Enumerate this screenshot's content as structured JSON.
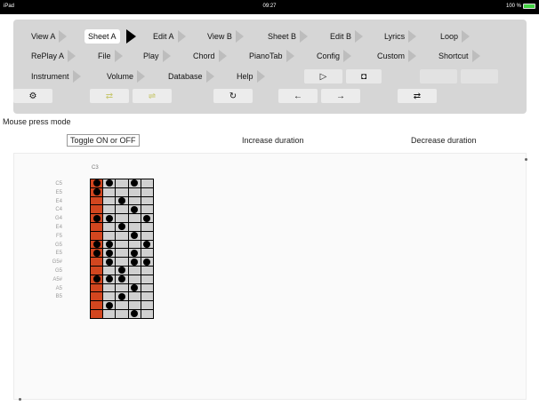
{
  "status_bar": {
    "device": "iPad",
    "time": "09:27",
    "battery": "100 %"
  },
  "menu": {
    "row1": [
      {
        "label": "View A",
        "active": false
      },
      {
        "label": "Sheet A",
        "active": true
      },
      {
        "label": "Edit A",
        "active": false
      },
      {
        "label": "View B",
        "active": false
      },
      {
        "label": "Sheet B",
        "active": false
      },
      {
        "label": "Edit B",
        "active": false
      },
      {
        "label": "Lyrics",
        "active": false
      },
      {
        "label": "Loop",
        "active": false
      }
    ],
    "row2": [
      {
        "label": "RePlay A"
      },
      {
        "label": "File"
      },
      {
        "label": "Play"
      },
      {
        "label": "Chord"
      },
      {
        "label": "PianoTab"
      },
      {
        "label": "Config"
      },
      {
        "label": "Custom"
      },
      {
        "label": "Shortcut"
      }
    ],
    "row3": [
      {
        "label": "Instrument"
      },
      {
        "label": "Volume"
      },
      {
        "label": "Database"
      },
      {
        "label": "Help"
      }
    ]
  },
  "tools": {
    "play": "▷",
    "stop": "◘",
    "settings": "⚙",
    "shuffle": "⇄",
    "swap": "⇌",
    "undo": "↻",
    "left": "←",
    "right": "→",
    "insert": "⇄"
  },
  "mode": {
    "label": "Mouse press mode",
    "options": [
      "Toggle ON or OFF",
      "Increase duration",
      "Decrease duration"
    ],
    "selected": 0
  },
  "grid": {
    "title": "C3",
    "notes": [
      "C5",
      "E5",
      "E4",
      "C4",
      "G4",
      "E4",
      "F5",
      "G5",
      "E5",
      "G5#",
      "G5",
      "A5#",
      "A5",
      "B5"
    ],
    "dots": [
      [
        0,
        1,
        3
      ],
      [
        0
      ],
      [
        2
      ],
      [
        3
      ],
      [
        0,
        1,
        4
      ],
      [
        2
      ],
      [
        3
      ],
      [
        0,
        1,
        4
      ],
      [
        0,
        1,
        3
      ],
      [
        1,
        3,
        4
      ],
      [
        2
      ],
      [
        0,
        1,
        2
      ],
      [
        3
      ],
      [
        2
      ],
      [
        1
      ],
      [
        3
      ]
    ]
  }
}
